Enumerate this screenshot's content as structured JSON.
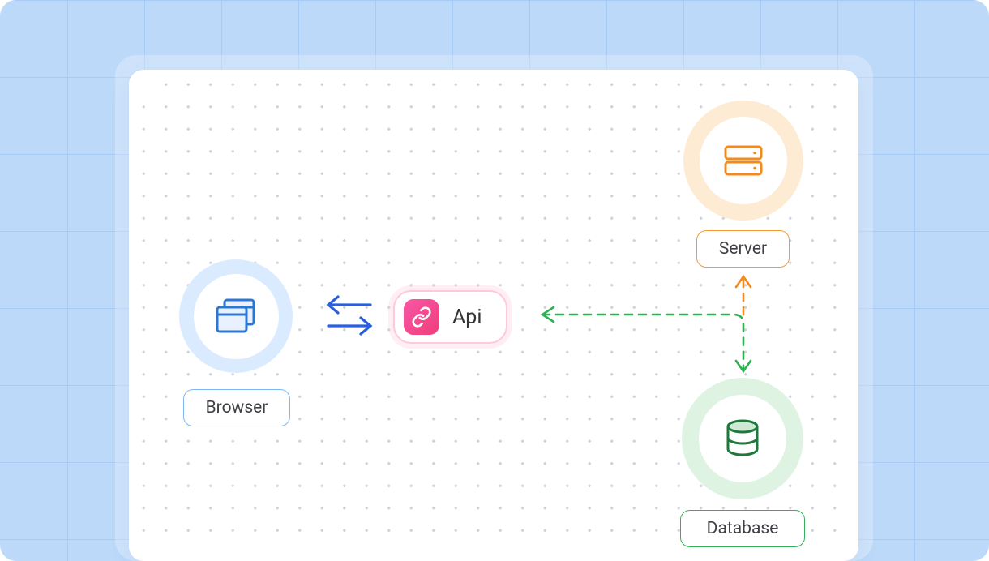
{
  "nodes": {
    "browser": {
      "label": "Browser"
    },
    "api": {
      "label": "Api"
    },
    "server": {
      "label": "Server"
    },
    "database": {
      "label": "Database"
    }
  },
  "colors": {
    "browser_ring": "#dbebff",
    "browser_border": "#7fb7f3",
    "browser_icon": "#2a77d6",
    "api_border": "#ffc8dd",
    "api_icon_bg1": "#f857a6",
    "api_icon_bg2": "#ef3e7a",
    "server_ring": "#fdebd4",
    "server_border": "#f39b3a",
    "server_icon": "#f28b1e",
    "db_ring": "#dff3e3",
    "db_border": "#34b05a",
    "db_icon": "#1d7a3a",
    "arrow_blue": "#2a5fe0",
    "arrow_green": "#2db155",
    "arrow_orange": "#f28b1e",
    "grid_bg": "#bcd9fa",
    "grid_line": "#A8CBF5"
  }
}
